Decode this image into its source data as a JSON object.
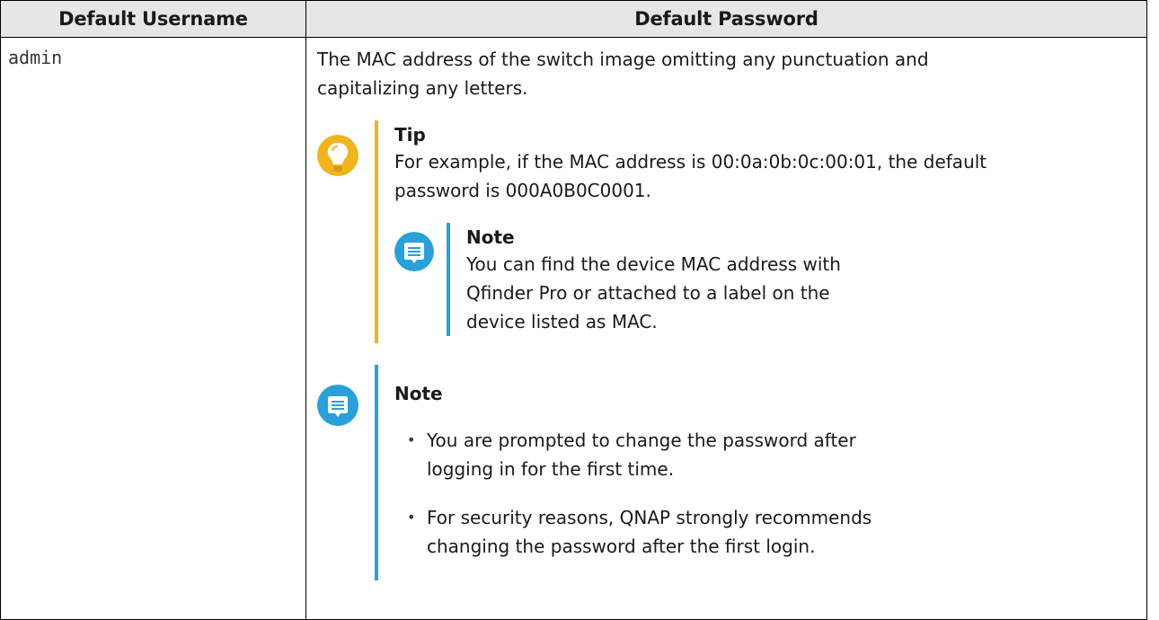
{
  "table": {
    "headers": {
      "username": "Default Username",
      "password": "Default Password"
    },
    "row": {
      "username": "admin",
      "password_description": "The MAC address of the switch image omitting any punctuation and capitalizing any letters."
    }
  },
  "tip": {
    "icon": "lightbulb-icon",
    "title": "Tip",
    "text": "For example, if the MAC address is 00:0a:0b:0c:00:01, the default password is 000A0B0C0001.",
    "note": {
      "icon": "note-icon",
      "title": "Note",
      "text": "You can find the device MAC address with Qfinder Pro or attached to a label on the device listed as MAC."
    }
  },
  "note": {
    "icon": "note-icon",
    "title": "Note",
    "items": [
      "You are prompted to change the password after logging in for the first time.",
      "For security reasons, QNAP strongly recommends changing the password after the first login."
    ]
  },
  "colors": {
    "tip_accent": "#f0b41e",
    "note_accent": "#2aa0d8",
    "header_bg": "#e6e6e6"
  }
}
